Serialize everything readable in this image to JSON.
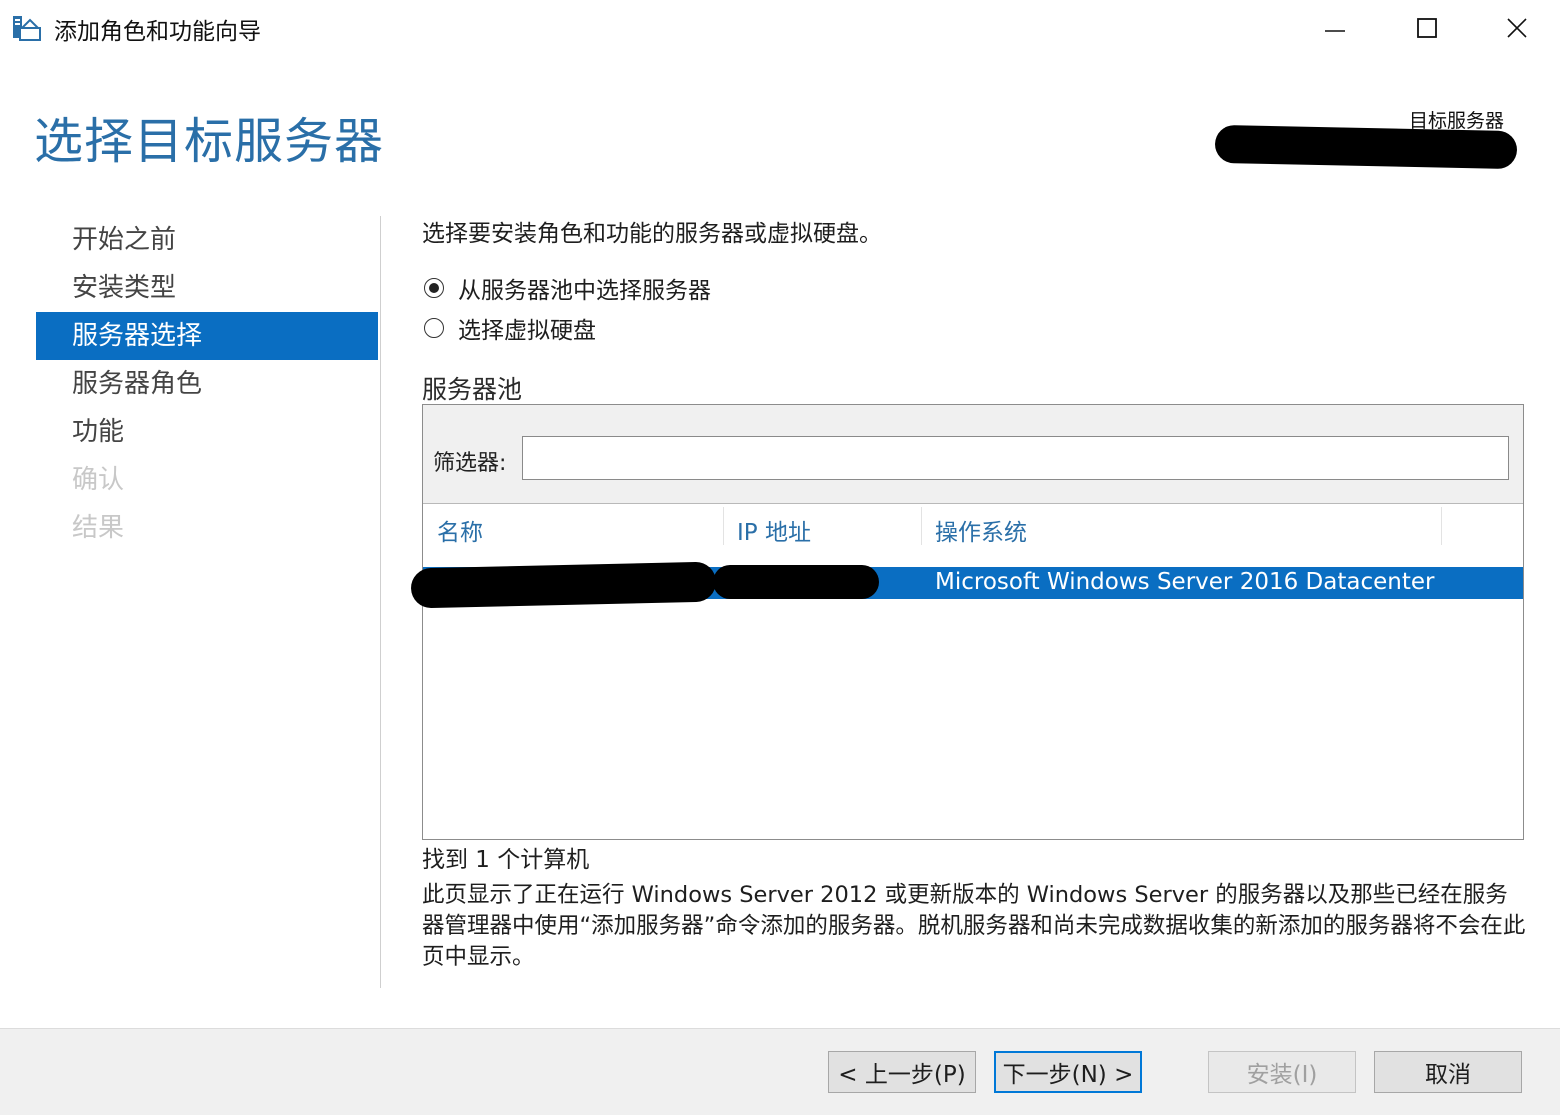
{
  "window": {
    "title": "添加角色和功能向导",
    "controls": [
      "minimize-icon",
      "maximize-icon",
      "close-icon"
    ]
  },
  "header": {
    "page_title": "选择目标服务器",
    "target_label": "目标服务器"
  },
  "nav": {
    "items": [
      {
        "label": "开始之前",
        "state": "normal"
      },
      {
        "label": "安装类型",
        "state": "normal"
      },
      {
        "label": "服务器选择",
        "state": "active"
      },
      {
        "label": "服务器角色",
        "state": "normal"
      },
      {
        "label": "功能",
        "state": "normal"
      },
      {
        "label": "确认",
        "state": "disabled"
      },
      {
        "label": "结果",
        "state": "disabled"
      }
    ]
  },
  "main": {
    "intro": "选择要安装角色和功能的服务器或虚拟硬盘。",
    "options": [
      {
        "label": "从服务器池中选择服务器",
        "selected": true
      },
      {
        "label": "选择虚拟硬盘",
        "selected": false
      }
    ],
    "pool": {
      "section_label": "服务器池",
      "filter_label": "筛选器:",
      "filter_value": "",
      "columns": [
        "名称",
        "IP 地址",
        "操作系统"
      ],
      "rows": [
        {
          "name": "",
          "ip": "",
          "os": "Microsoft Windows Server 2016 Datacenter",
          "selected": true
        }
      ]
    },
    "found": "找到 1 个计算机",
    "description": "此页显示了正在运行 Windows Server 2012 或更新版本的 Windows Server 的服务器以及那些已经在服务器管理器中使用“添加服务器”命令添加的服务器。脱机服务器和尚未完成数据收集的新添加的服务器将不会在此页中显示。"
  },
  "footer": {
    "prev_label": "< 上一步(P)",
    "next_label": "下一步(N) >",
    "install_label": "安装(I)",
    "cancel_label": "取消"
  },
  "colors": {
    "accent": "#0a6ec2",
    "title_blue": "#2a6fa8",
    "disabled_text": "#c8c8c8"
  }
}
